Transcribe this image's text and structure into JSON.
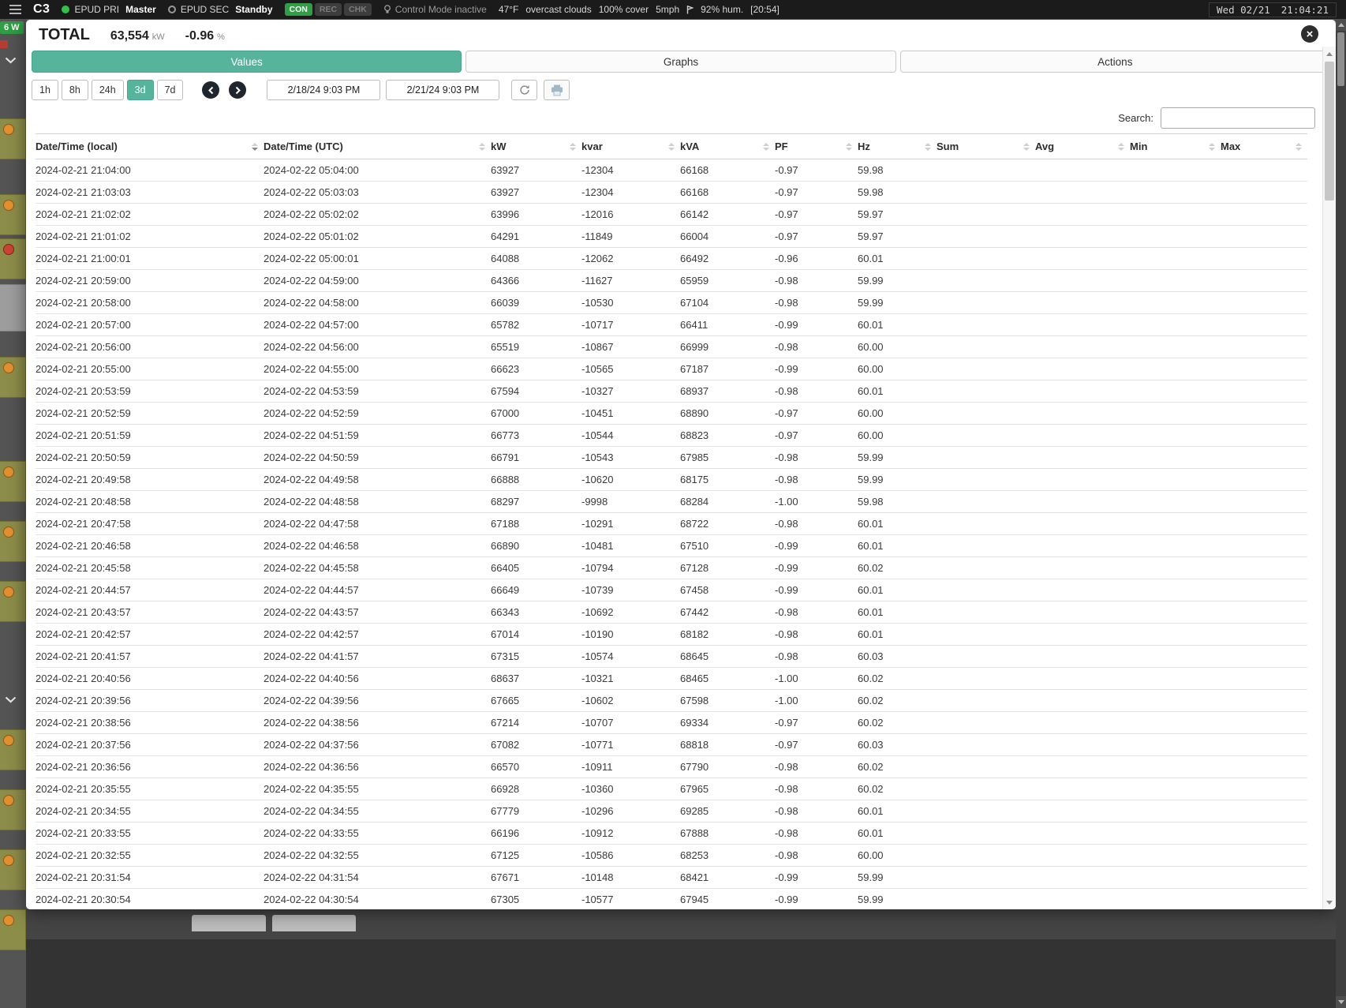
{
  "topbar": {
    "app_name": "C3",
    "pri": {
      "label": "EPUD PRI",
      "state": "Master"
    },
    "sec": {
      "label": "EPUD SEC",
      "state": "Standby"
    },
    "badges": [
      {
        "label": "CON",
        "active": true
      },
      {
        "label": "REC",
        "active": false
      },
      {
        "label": "CHK",
        "active": false
      }
    ],
    "control_mode": "Control Mode inactive",
    "weather": {
      "temp": "47°F",
      "desc": "overcast clouds",
      "cover": "100% cover",
      "wind": "5mph",
      "humidity": "92% hum.",
      "time_tag": "[20:54]"
    },
    "clock_date": "Wed 02/21",
    "clock_time": "21:04:21"
  },
  "background": {
    "badge": "6 W"
  },
  "modal": {
    "title": "TOTAL",
    "value": "63,554",
    "value_unit": "kW",
    "delta": "-0.96",
    "delta_unit": "%",
    "tabs": [
      {
        "label": "Values",
        "active": true
      },
      {
        "label": "Graphs",
        "active": false
      },
      {
        "label": "Actions",
        "active": false
      }
    ],
    "toolbar": {
      "ranges": [
        {
          "label": "1h",
          "active": false
        },
        {
          "label": "8h",
          "active": false
        },
        {
          "label": "24h",
          "active": false
        },
        {
          "label": "3d",
          "active": true
        },
        {
          "label": "7d",
          "active": false
        }
      ],
      "date_from": "2/18/24 9:03 PM",
      "date_to": "2/21/24 9:03 PM"
    },
    "search_label": "Search:",
    "table": {
      "columns": [
        "Date/Time (local)",
        "Date/Time (UTC)",
        "kW",
        "kvar",
        "kVA",
        "PF",
        "Hz",
        "Sum",
        "Avg",
        "Min",
        "Max"
      ],
      "rows": [
        [
          "2024-02-21 21:04:00",
          "2024-02-22 05:04:00",
          "63927",
          "-12304",
          "66168",
          "-0.97",
          "59.98"
        ],
        [
          "2024-02-21 21:03:03",
          "2024-02-22 05:03:03",
          "63927",
          "-12304",
          "66168",
          "-0.97",
          "59.98"
        ],
        [
          "2024-02-21 21:02:02",
          "2024-02-22 05:02:02",
          "63996",
          "-12016",
          "66142",
          "-0.97",
          "59.97"
        ],
        [
          "2024-02-21 21:01:02",
          "2024-02-22 05:01:02",
          "64291",
          "-11849",
          "66004",
          "-0.97",
          "59.97"
        ],
        [
          "2024-02-21 21:00:01",
          "2024-02-22 05:00:01",
          "64088",
          "-12062",
          "66492",
          "-0.96",
          "60.01"
        ],
        [
          "2024-02-21 20:59:00",
          "2024-02-22 04:59:00",
          "64366",
          "-11627",
          "65959",
          "-0.98",
          "59.99"
        ],
        [
          "2024-02-21 20:58:00",
          "2024-02-22 04:58:00",
          "66039",
          "-10530",
          "67104",
          "-0.98",
          "59.99"
        ],
        [
          "2024-02-21 20:57:00",
          "2024-02-22 04:57:00",
          "65782",
          "-10717",
          "66411",
          "-0.99",
          "60.01"
        ],
        [
          "2024-02-21 20:56:00",
          "2024-02-22 04:56:00",
          "65519",
          "-10867",
          "66999",
          "-0.98",
          "60.00"
        ],
        [
          "2024-02-21 20:55:00",
          "2024-02-22 04:55:00",
          "66623",
          "-10565",
          "67187",
          "-0.99",
          "60.00"
        ],
        [
          "2024-02-21 20:53:59",
          "2024-02-22 04:53:59",
          "67594",
          "-10327",
          "68937",
          "-0.98",
          "60.01"
        ],
        [
          "2024-02-21 20:52:59",
          "2024-02-22 04:52:59",
          "67000",
          "-10451",
          "68890",
          "-0.97",
          "60.00"
        ],
        [
          "2024-02-21 20:51:59",
          "2024-02-22 04:51:59",
          "66773",
          "-10544",
          "68823",
          "-0.97",
          "60.00"
        ],
        [
          "2024-02-21 20:50:59",
          "2024-02-22 04:50:59",
          "66791",
          "-10543",
          "67985",
          "-0.98",
          "59.99"
        ],
        [
          "2024-02-21 20:49:58",
          "2024-02-22 04:49:58",
          "66888",
          "-10620",
          "68175",
          "-0.98",
          "59.99"
        ],
        [
          "2024-02-21 20:48:58",
          "2024-02-22 04:48:58",
          "68297",
          "-9998",
          "68284",
          "-1.00",
          "59.98"
        ],
        [
          "2024-02-21 20:47:58",
          "2024-02-22 04:47:58",
          "67188",
          "-10291",
          "68722",
          "-0.98",
          "60.01"
        ],
        [
          "2024-02-21 20:46:58",
          "2024-02-22 04:46:58",
          "66890",
          "-10481",
          "67510",
          "-0.99",
          "60.01"
        ],
        [
          "2024-02-21 20:45:58",
          "2024-02-22 04:45:58",
          "66405",
          "-10794",
          "67128",
          "-0.99",
          "60.02"
        ],
        [
          "2024-02-21 20:44:57",
          "2024-02-22 04:44:57",
          "66649",
          "-10739",
          "67458",
          "-0.99",
          "60.01"
        ],
        [
          "2024-02-21 20:43:57",
          "2024-02-22 04:43:57",
          "66343",
          "-10692",
          "67442",
          "-0.98",
          "60.01"
        ],
        [
          "2024-02-21 20:42:57",
          "2024-02-22 04:42:57",
          "67014",
          "-10190",
          "68182",
          "-0.98",
          "60.01"
        ],
        [
          "2024-02-21 20:41:57",
          "2024-02-22 04:41:57",
          "67315",
          "-10574",
          "68645",
          "-0.98",
          "60.03"
        ],
        [
          "2024-02-21 20:40:56",
          "2024-02-22 04:40:56",
          "68637",
          "-10321",
          "68465",
          "-1.00",
          "60.02"
        ],
        [
          "2024-02-21 20:39:56",
          "2024-02-22 04:39:56",
          "67665",
          "-10602",
          "67598",
          "-1.00",
          "60.02"
        ],
        [
          "2024-02-21 20:38:56",
          "2024-02-22 04:38:56",
          "67214",
          "-10707",
          "69334",
          "-0.97",
          "60.02"
        ],
        [
          "2024-02-21 20:37:56",
          "2024-02-22 04:37:56",
          "67082",
          "-10771",
          "68818",
          "-0.97",
          "60.03"
        ],
        [
          "2024-02-21 20:36:56",
          "2024-02-22 04:36:56",
          "66570",
          "-10911",
          "67790",
          "-0.98",
          "60.02"
        ],
        [
          "2024-02-21 20:35:55",
          "2024-02-22 04:35:55",
          "66928",
          "-10360",
          "67965",
          "-0.98",
          "60.02"
        ],
        [
          "2024-02-21 20:34:55",
          "2024-02-22 04:34:55",
          "67779",
          "-10296",
          "69285",
          "-0.98",
          "60.01"
        ],
        [
          "2024-02-21 20:33:55",
          "2024-02-22 04:33:55",
          "66196",
          "-10912",
          "67888",
          "-0.98",
          "60.01"
        ],
        [
          "2024-02-21 20:32:55",
          "2024-02-22 04:32:55",
          "67125",
          "-10586",
          "68253",
          "-0.98",
          "60.00"
        ],
        [
          "2024-02-21 20:31:54",
          "2024-02-22 04:31:54",
          "67671",
          "-10148",
          "68421",
          "-0.99",
          "59.99"
        ],
        [
          "2024-02-21 20:30:54",
          "2024-02-22 04:30:54",
          "67305",
          "-10577",
          "67945",
          "-0.99",
          "59.99"
        ]
      ]
    }
  }
}
